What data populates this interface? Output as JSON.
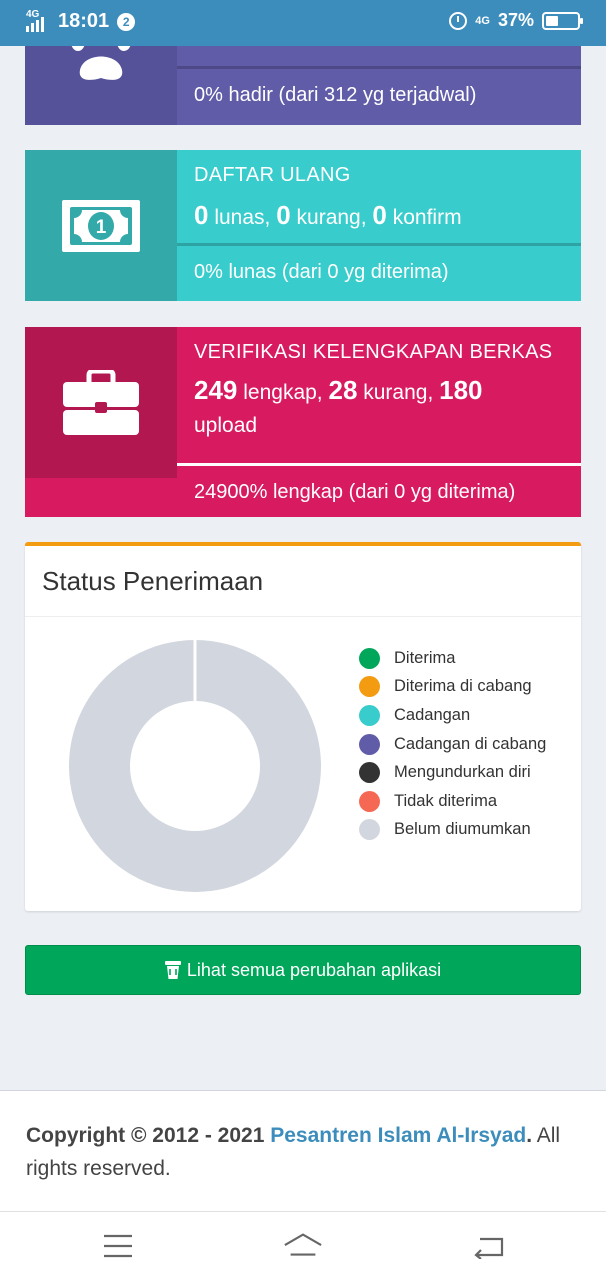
{
  "status_bar": {
    "network_left": "4G",
    "time": "18:01",
    "notification_count": "2",
    "network_right": "4G",
    "battery": "37%"
  },
  "boxes": {
    "attendance": {
      "icon": "paw-icon",
      "description": "0% hadir (dari 312 yg terjadwal)",
      "progress": 0
    },
    "re_registration": {
      "icon": "money-icon",
      "title": "DAFTAR ULANG",
      "paid_count": "0",
      "paid_label": "lunas,",
      "short_count": "0",
      "short_label": "kurang,",
      "confirm_count": "0",
      "confirm_label": "konfirm",
      "description": "0% lunas (dari 0 yg diterima)",
      "progress": 0
    },
    "verification": {
      "icon": "briefcase-icon",
      "title": "VERIFIKASI KELENGKAPAN BERKAS",
      "complete_count": "249",
      "complete_label": "lengkap,",
      "short_count": "28",
      "short_label": "kurang,",
      "upload_count": "180",
      "upload_label": "upload",
      "description": "24900% lengkap (dari 0 yg diterima)",
      "progress": 100
    }
  },
  "status_panel": {
    "title": "Status Penerimaan",
    "legend": [
      {
        "label": "Diterima",
        "color": "#00a65a"
      },
      {
        "label": "Diterima di cabang",
        "color": "#f39c12"
      },
      {
        "label": "Cadangan",
        "color": "#39cccc"
      },
      {
        "label": "Cadangan di cabang",
        "color": "#605ca8"
      },
      {
        "label": "Mengundurkan diri",
        "color": "#333333"
      },
      {
        "label": "Tidak diterima",
        "color": "#f56954"
      },
      {
        "label": "Belum diumumkan",
        "color": "#d2d6de"
      }
    ]
  },
  "chart_data": {
    "type": "pie",
    "donut": true,
    "title": "",
    "categories": [
      "Diterima",
      "Diterima di cabang",
      "Cadangan",
      "Cadangan di cabang",
      "Mengundurkan diri",
      "Tidak diterima",
      "Belum diumumkan"
    ],
    "values": [
      0,
      0,
      0,
      0,
      0,
      0,
      100
    ],
    "colors": [
      "#00a65a",
      "#f39c12",
      "#39cccc",
      "#605ca8",
      "#333333",
      "#f56954",
      "#d2d6de"
    ],
    "legend_position": "right"
  },
  "changes_button": {
    "icon": "trash-can-icon",
    "label": "Lihat semua perubahan aplikasi"
  },
  "footer": {
    "prefix": "Copyright © 2012 - 2021 ",
    "org": "Pesantren Islam Al-Irsyad",
    "period": ".",
    "suffix": " All rights reserved."
  },
  "nav": {
    "menu_icon": "menu-icon",
    "home_icon": "home-icon",
    "back_icon": "back-icon"
  }
}
